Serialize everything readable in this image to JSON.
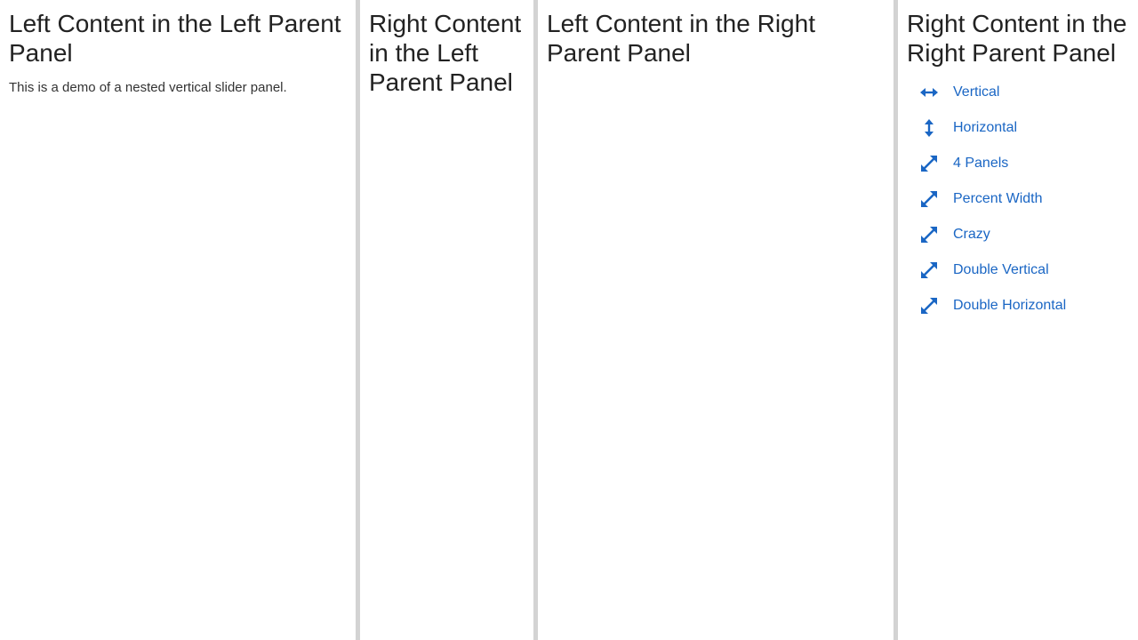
{
  "left_parent": {
    "left_panel": {
      "title": "Left Content in the Left Parent Panel",
      "description": "This is a demo of a nested vertical slider panel."
    },
    "right_panel": {
      "title": "Right Content in the Left Parent Panel"
    }
  },
  "right_parent": {
    "left_panel": {
      "title": "Left Content in the Right Parent Panel"
    },
    "right_panel": {
      "title": "Right Content in the Right Parent Panel",
      "links": [
        {
          "label": "Vertical",
          "icon": "horizontal-arrows-icon"
        },
        {
          "label": "Horizontal",
          "icon": "vertical-arrows-icon"
        },
        {
          "label": "4 Panels",
          "icon": "diagonal-arrows-icon"
        },
        {
          "label": "Percent Width",
          "icon": "diagonal-arrows-icon"
        },
        {
          "label": "Crazy",
          "icon": "diagonal-arrows-icon"
        },
        {
          "label": "Double Vertical",
          "icon": "diagonal-arrows-icon"
        },
        {
          "label": "Double Horizontal",
          "icon": "diagonal-arrows-icon"
        }
      ]
    }
  },
  "colors": {
    "link": "#1a66c4",
    "splitter": "#d3d3d3",
    "heading": "#222222"
  }
}
